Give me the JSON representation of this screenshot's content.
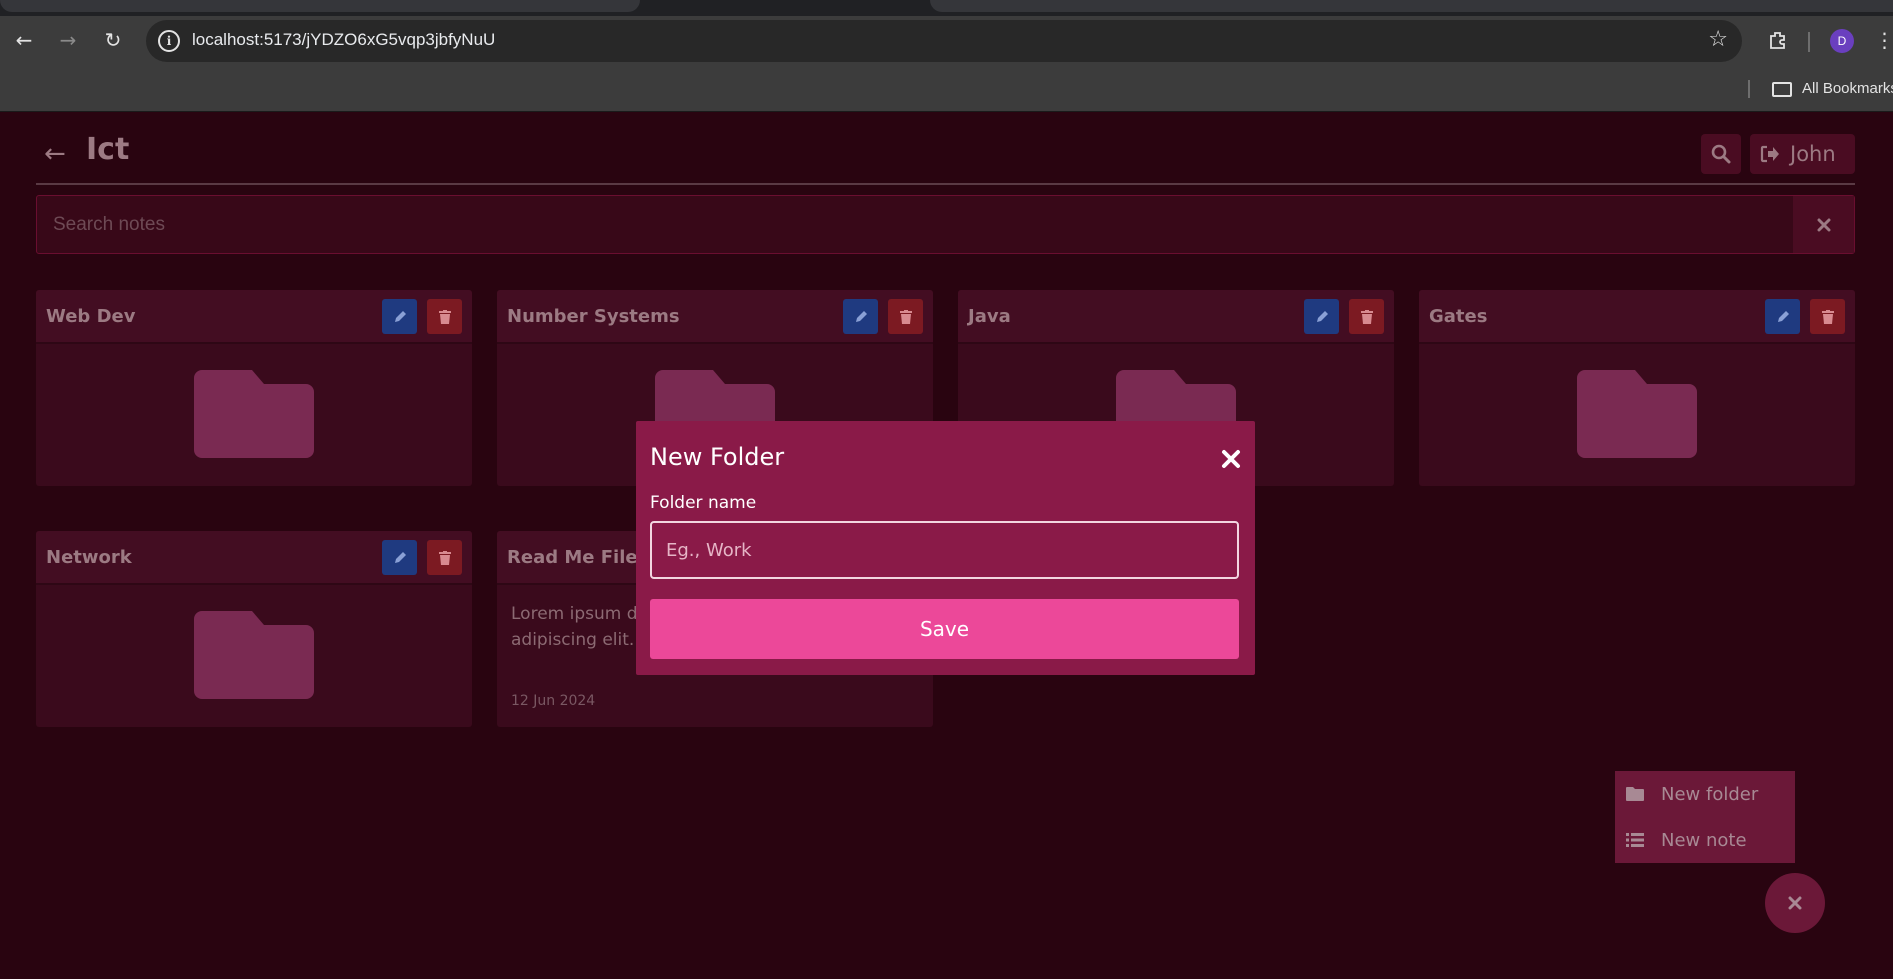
{
  "browser": {
    "url": "localhost:5173/jYDZO6xG5vqp3jbfyNuU",
    "profile_initial": "D",
    "bookmarks_label": "All Bookmarks"
  },
  "header": {
    "title": "Ict",
    "user_name": "John"
  },
  "search": {
    "placeholder": "Search notes"
  },
  "folders": [
    {
      "title": "Web Dev"
    },
    {
      "title": "Number Systems"
    },
    {
      "title": "Java"
    },
    {
      "title": "Gates"
    },
    {
      "title": "Network"
    }
  ],
  "note": {
    "title": "Read Me File",
    "body_line1": "Lorem ipsum d",
    "body_line2": "adipiscing elit.",
    "date": "12 Jun 2024"
  },
  "modal": {
    "title": "New Folder",
    "label": "Folder name",
    "placeholder": "Eg., Work",
    "value": "",
    "save_label": "Save"
  },
  "fab_menu": {
    "new_folder_label": "New folder",
    "new_note_label": "New note"
  },
  "colors": {
    "background": "#290410",
    "card": "#3a0a1c",
    "modal": "#8a1a48",
    "save_button": "#ec4899",
    "edit_button": "#1f3a80",
    "delete_button": "#7c1a22"
  }
}
